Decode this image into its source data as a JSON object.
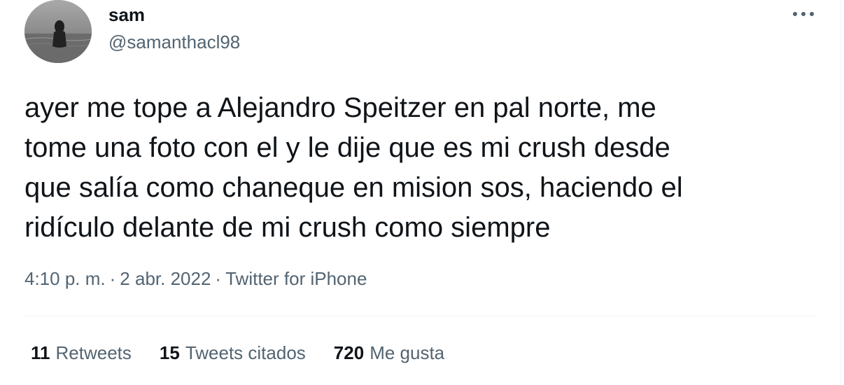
{
  "author": {
    "display_name": "sam",
    "handle": "@samanthacl98"
  },
  "tweet": {
    "lines": [
      "ayer me tope a Alejandro Speitzer en pal norte, me",
      "tome una foto con el y le dije que es mi crush desde",
      "que salía como chaneque en mision sos, haciendo el",
      "ridículo delante de mi crush como siempre"
    ]
  },
  "meta": {
    "time": "4:10 p. m.",
    "separator": "·",
    "date": "2 abr. 2022",
    "source": "Twitter for iPhone"
  },
  "stats": [
    {
      "count": "11",
      "label": "Retweets"
    },
    {
      "count": "15",
      "label": "Tweets citados"
    },
    {
      "count": "720",
      "label": "Me gusta"
    }
  ],
  "icons": {
    "more": "more-horizontal-icon"
  },
  "colors": {
    "text_primary": "#0f1419",
    "text_secondary": "#536471",
    "divider": "#eff3f4"
  }
}
